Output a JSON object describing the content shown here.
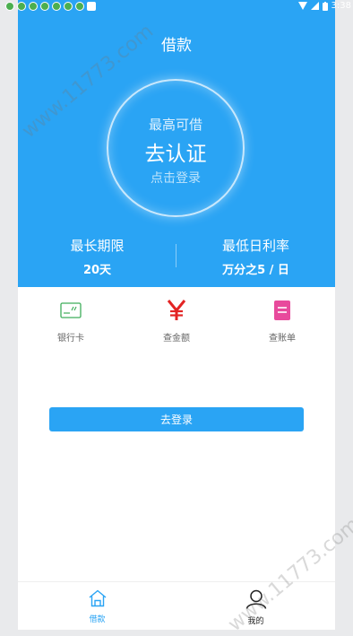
{
  "status_bar": {
    "time": "3:38",
    "notification_icon_count": 8
  },
  "header": {
    "title": "借款"
  },
  "circle": {
    "subtitle": "最高可借",
    "main": "去认证",
    "hint": "点击登录"
  },
  "stats": [
    {
      "label": "最长期限",
      "value": "20天"
    },
    {
      "label": "最低日利率",
      "value": "万分之5 / 日"
    }
  ],
  "quick_actions": [
    {
      "label": "银行卡",
      "icon": "bank-card-icon",
      "color": "#3fae5a"
    },
    {
      "label": "查金额",
      "icon": "yen-icon",
      "color": "#e32424"
    },
    {
      "label": "查账单",
      "icon": "bill-icon",
      "color": "#e84a9c"
    }
  ],
  "login_button": {
    "label": "去登录"
  },
  "tabbar": {
    "items": [
      {
        "label": "借款",
        "icon": "home-icon",
        "active": true
      },
      {
        "label": "我的",
        "icon": "user-icon",
        "active": false
      }
    ],
    "active_color": "#2aa4f4"
  },
  "watermark": {
    "text": "www.11773.com"
  },
  "colors": {
    "primary": "#2aa4f4"
  }
}
